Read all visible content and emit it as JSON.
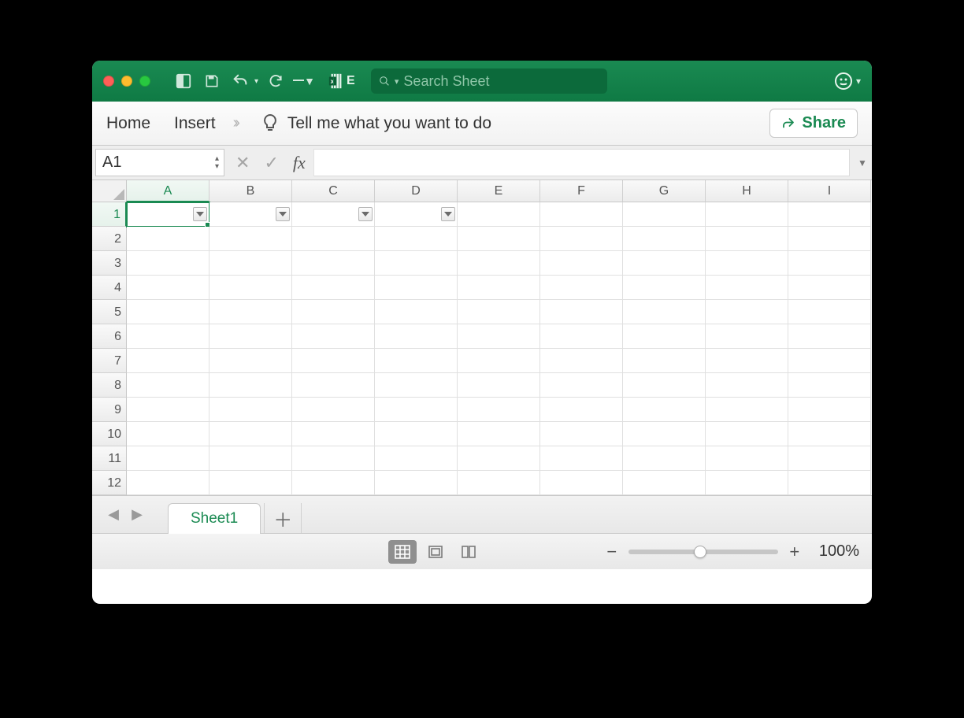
{
  "titlebar": {
    "app_badge": "E",
    "search_placeholder": "Search Sheet"
  },
  "ribbon": {
    "tabs": [
      "Home",
      "Insert"
    ],
    "tellme": "Tell me what you want to do",
    "share": "Share"
  },
  "namebox": {
    "value": "A1"
  },
  "formula": {
    "fx": "fx",
    "value": ""
  },
  "grid": {
    "columns": [
      "A",
      "B",
      "C",
      "D",
      "E",
      "F",
      "G",
      "H",
      "I"
    ],
    "rows": [
      "1",
      "2",
      "3",
      "4",
      "5",
      "6",
      "7",
      "8",
      "9",
      "10",
      "11",
      "12"
    ],
    "active_col": "A",
    "active_row": "1",
    "selection": "A1",
    "filter_cols": [
      "A",
      "B",
      "C",
      "D"
    ]
  },
  "sheets": {
    "active": "Sheet1"
  },
  "status": {
    "zoom": "100%"
  }
}
